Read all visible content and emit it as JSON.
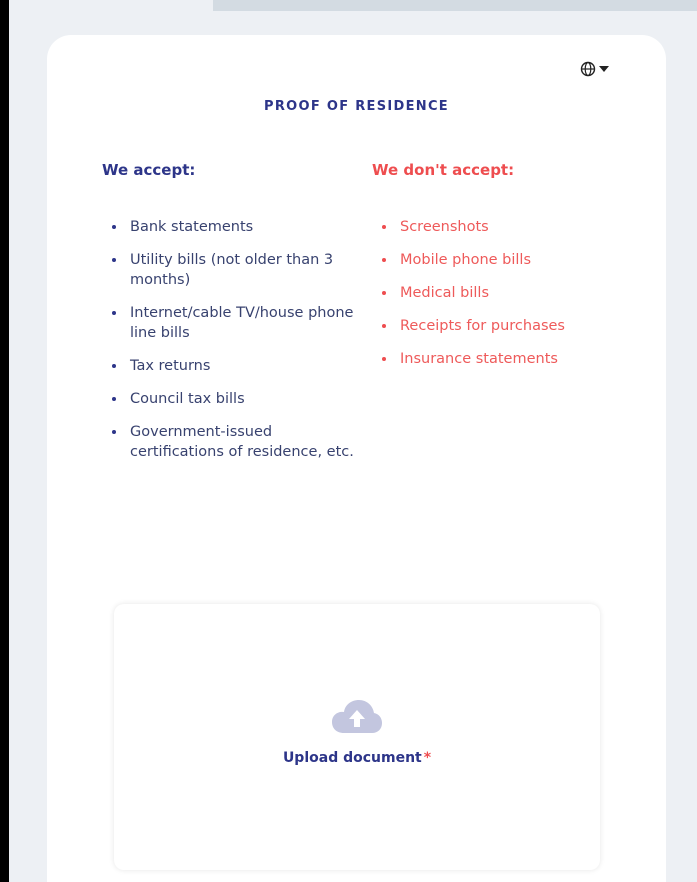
{
  "header": {
    "language_icon": "globe-icon",
    "dropdown_icon": "caret-down-icon"
  },
  "page": {
    "title": "PROOF OF RESIDENCE"
  },
  "accept": {
    "heading": "We accept:",
    "items": [
      "Bank statements",
      "Utility bills (not older than 3 months)",
      "Internet/cable TV/house phone line bills",
      "Tax returns",
      "Council tax bills",
      "Government-issued certifications of residence, etc."
    ]
  },
  "reject": {
    "heading": "We don't accept:",
    "items": [
      "Screenshots",
      "Mobile phone bills",
      "Medical bills",
      "Receipts for purchases",
      "Insurance statements"
    ]
  },
  "upload": {
    "icon": "cloud-upload-icon",
    "label": "Upload document",
    "required_mark": "*"
  },
  "colors": {
    "brand": "#2d3589",
    "reject": "#ee4d4f",
    "icon_muted": "#c3c6df"
  }
}
